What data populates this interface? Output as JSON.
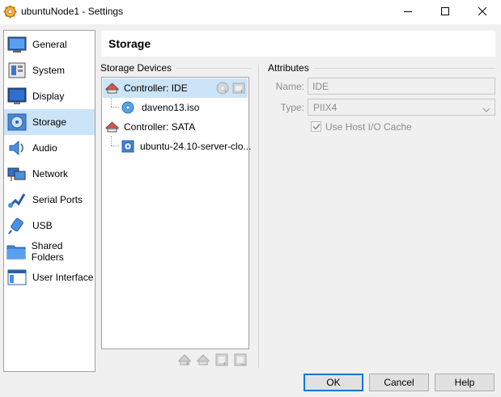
{
  "window": {
    "title": "ubuntuNode1 - Settings",
    "controls": {
      "minimize": "minimize-icon",
      "maximize": "maximize-icon",
      "close": "close-icon"
    }
  },
  "sidebar": {
    "items": [
      {
        "label": "General",
        "icon": "general-icon",
        "selected": false
      },
      {
        "label": "System",
        "icon": "system-icon",
        "selected": false
      },
      {
        "label": "Display",
        "icon": "display-icon",
        "selected": false
      },
      {
        "label": "Storage",
        "icon": "storage-icon",
        "selected": true
      },
      {
        "label": "Audio",
        "icon": "audio-icon",
        "selected": false
      },
      {
        "label": "Network",
        "icon": "network-icon",
        "selected": false
      },
      {
        "label": "Serial Ports",
        "icon": "serial-ports-icon",
        "selected": false
      },
      {
        "label": "USB",
        "icon": "usb-icon",
        "selected": false
      },
      {
        "label": "Shared Folders",
        "icon": "shared-folders-icon",
        "selected": false
      },
      {
        "label": "User Interface",
        "icon": "user-interface-icon",
        "selected": false
      }
    ]
  },
  "page": {
    "title": "Storage"
  },
  "storage_devices": {
    "group_title": "Storage Devices",
    "tree": [
      {
        "label": "Controller: IDE",
        "kind": "controller",
        "selected": true,
        "children": [
          {
            "label": "daveno13.iso",
            "kind": "optical"
          }
        ]
      },
      {
        "label": "Controller: SATA",
        "kind": "controller",
        "selected": false,
        "children": [
          {
            "label": "ubuntu-24.10-server-clo...",
            "kind": "disk"
          }
        ]
      }
    ],
    "toolbar": [
      "add-controller-icon",
      "remove-controller-icon",
      "add-attachment-icon",
      "remove-attachment-icon"
    ]
  },
  "attributes": {
    "group_title": "Attributes",
    "name_label": "Name:",
    "name_value": "IDE",
    "type_label": "Type:",
    "type_value": "PIIX4",
    "host_io_cache_label": "Use Host I/O Cache",
    "host_io_cache_checked": true
  },
  "buttons": {
    "ok": "OK",
    "cancel": "Cancel",
    "help": "Help"
  },
  "colors": {
    "selection": "#cce4f7",
    "accent": "#0078d7",
    "disabled_text": "#8c8c8c"
  }
}
